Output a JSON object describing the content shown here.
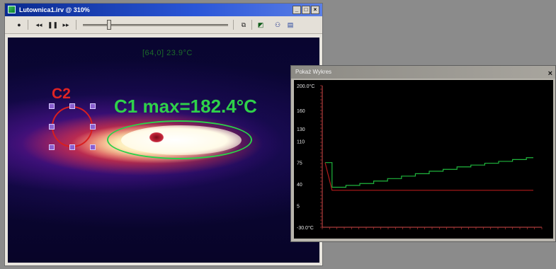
{
  "window": {
    "title": "Lutownica1.irv @ 310%",
    "btn_minimize": "_",
    "btn_maximize": "□",
    "btn_close": "×"
  },
  "toolbar": {
    "record": "●",
    "rewind": "◂◂",
    "pause": "❚❚",
    "forward": "▸▸",
    "copy": "⧉",
    "palette": "◩",
    "people": "⚇",
    "export": "▤",
    "slider_position": 0.18
  },
  "thermal": {
    "probe_readout": "[64,0] 23.9°C",
    "c1_label": "C1 max=182.4°C",
    "c2_label": "C2"
  },
  "graph": {
    "title": "Pokaż Wykres",
    "close": "×"
  },
  "chart_data": {
    "type": "line",
    "y_ticks": [
      "200.0°C",
      "160",
      "130",
      "110",
      "75",
      "40",
      "5",
      "-30.0°C"
    ],
    "ylim": [
      -30,
      200
    ],
    "series": [
      {
        "color": "#1fb53d",
        "style": "stepped",
        "values": [
          75,
          35,
          35,
          38,
          38,
          41,
          41,
          45,
          45,
          49,
          49,
          53,
          53,
          57,
          57,
          61,
          61,
          64,
          64,
          68,
          68,
          71,
          71,
          74,
          74,
          77,
          77,
          80,
          80,
          83,
          83
        ]
      },
      {
        "color": "#b01b1b",
        "style": "flat",
        "values": [
          75,
          30,
          30,
          30,
          30,
          30,
          30,
          30,
          30,
          30,
          30,
          30,
          30,
          30,
          30,
          30,
          30,
          30,
          30,
          30,
          30,
          30,
          30,
          30,
          30,
          30,
          30,
          30,
          30,
          30,
          30
        ]
      }
    ]
  }
}
